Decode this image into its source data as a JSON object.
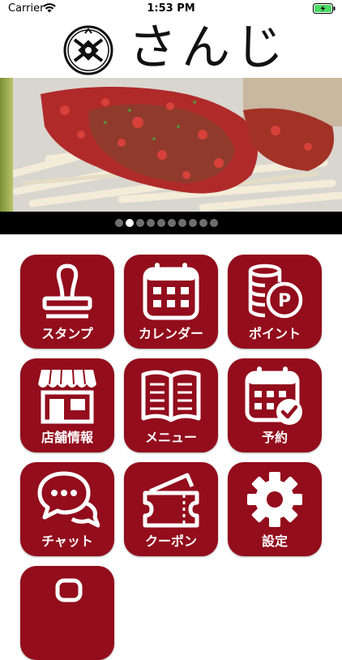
{
  "status_bar": {
    "carrier": "Carrier",
    "time": "1:53 PM"
  },
  "header": {
    "logo_text": "さんじ"
  },
  "banner": {
    "slide_count": 10,
    "active_index": 1
  },
  "menu": {
    "stamp": "スタンプ",
    "calendar": "カレンダー",
    "point": "ポイント",
    "store": "店舗情報",
    "menu": "メニュー",
    "reservation": "予約",
    "chat": "チャット",
    "coupon": "クーポン",
    "settings": "設定"
  },
  "colors": {
    "accent": "#930d1c",
    "pager_bg": "#000000"
  }
}
